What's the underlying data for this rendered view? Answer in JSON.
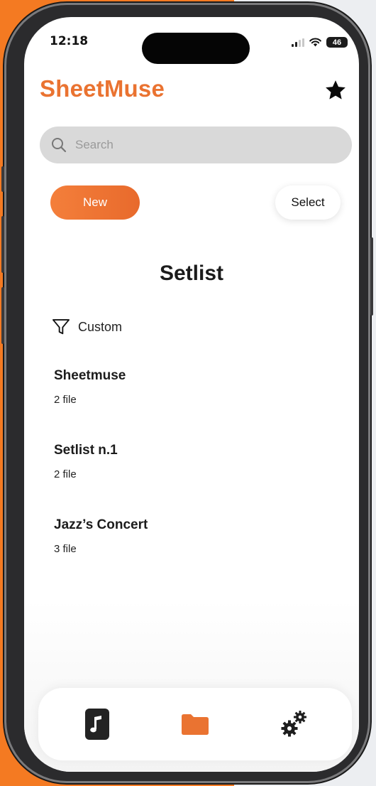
{
  "status_bar": {
    "time": "12:18",
    "battery": "46"
  },
  "app": {
    "title": "SheetMuse",
    "accent_color": "#EA7331"
  },
  "header": {
    "favorite_icon": "star-icon"
  },
  "search": {
    "placeholder": "Search",
    "value": ""
  },
  "actions": {
    "new_label": "New",
    "select_label": "Select"
  },
  "section": {
    "title": "Setlist"
  },
  "filter": {
    "label": "Custom",
    "icon": "filter-icon"
  },
  "setlists": [
    {
      "name": "Sheetmuse",
      "count": "2 file"
    },
    {
      "name": "Setlist n.1",
      "count": "2 file"
    },
    {
      "name": "Jazz’s Concert",
      "count": "3 file"
    }
  ],
  "tabs": [
    {
      "icon": "music-note-icon",
      "active": false
    },
    {
      "icon": "folder-icon",
      "active": true
    },
    {
      "icon": "gears-icon",
      "active": false
    }
  ]
}
